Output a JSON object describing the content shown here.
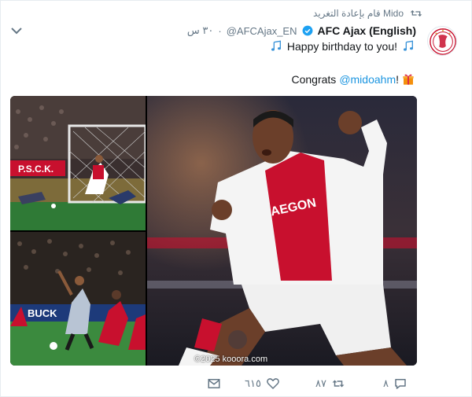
{
  "retweeter": {
    "text": "Mido قام بإعادة التغريد"
  },
  "tweet": {
    "author_name": "AFC Ajax (English)",
    "handle": "@AFCAjax_EN",
    "time": "٣٠ س",
    "line1": "Happy birthday to you!",
    "congrats_prefix": "Congrats",
    "mention": "@midoahm",
    "congrats_suffix": "!",
    "watermark": "©2025 kooora.com"
  },
  "actions": {
    "reply_count": "٨",
    "retweet_count": "٨٧",
    "like_count": "٦١٥"
  },
  "colors": {
    "accent": "#1b95e0",
    "muted": "#657786",
    "ajax_red": "#c8102e"
  },
  "icons": {
    "retweet": "retweet-icon",
    "verified": "verified-badge-icon",
    "music": "music-note-icon",
    "gift": "gift-icon",
    "caret": "chevron-down-icon",
    "reply": "reply-icon",
    "like": "heart-icon",
    "dm": "envelope-icon"
  }
}
